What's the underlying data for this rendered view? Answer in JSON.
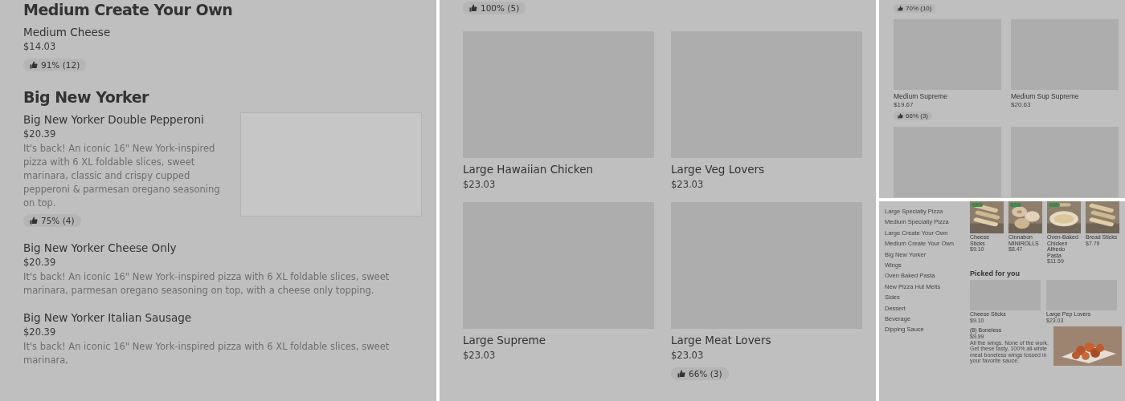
{
  "list_view": {
    "sections": [
      {
        "heading": "Medium Create Your Own",
        "items": [
          {
            "name": "Medium Cheese",
            "price": "$14.03",
            "rating": "91% (12)"
          }
        ]
      },
      {
        "heading": "Big New Yorker",
        "items": [
          {
            "name": "Big New Yorker Double Pepperoni",
            "price": "$20.39",
            "description": "It's back! An iconic 16\" New York-inspired pizza with 6 XL foldable slices, sweet marinara, classic and crispy cupped pepperoni & parmesan oregano seasoning on top.",
            "rating": "75% (4)",
            "image": true
          },
          {
            "name": "Big New Yorker Cheese Only",
            "price": "$20.39",
            "description": "It's back! An iconic 16\" New York-inspired pizza with 6 XL foldable slices, sweet marinara, parmesan oregano seasoning on top, with a cheese only topping."
          },
          {
            "name": "Big New Yorker Italian Sausage",
            "price": "$20.39",
            "description": "It's back! An iconic 16\" New York-inspired pizza with 6 XL foldable slices, sweet marinara,"
          }
        ]
      }
    ]
  },
  "grid_view": {
    "top_rating": "100% (5)",
    "cards": [
      {
        "name": "Large Hawaiian Chicken",
        "price": "$23.03"
      },
      {
        "name": "Large Veg Lovers",
        "price": "$23.03"
      },
      {
        "name": "Large Supreme",
        "price": "$23.03"
      },
      {
        "name": "Large Meat Lovers",
        "price": "$23.03",
        "rating": "66% (3)"
      }
    ]
  },
  "compact_grid_view": {
    "top_rating": "70% (10)",
    "cards": [
      {
        "image": true,
        "name": "Medium Supreme",
        "price": "$19.67",
        "rating": "66% (3)"
      },
      {
        "image": true,
        "name": "Medium Sup Supreme",
        "price": "$20.63"
      },
      {
        "image": true
      },
      {
        "image": true
      }
    ]
  },
  "mobile_view": {
    "categories": [
      {
        "label": "Large Specialty Pizza"
      },
      {
        "label": "Medium Specialty Pizza"
      },
      {
        "label": "Large Create Your Own"
      },
      {
        "label": "Medium Create Your Own"
      },
      {
        "label": "Big New Yorker"
      },
      {
        "label": "Wings"
      },
      {
        "label": "Oven Baked Pasta"
      },
      {
        "label": "New Pizza Hut Melts"
      },
      {
        "label": "Sides"
      },
      {
        "label": "Dessert"
      },
      {
        "label": "Beverage"
      },
      {
        "label": "Dipping Sauce"
      }
    ],
    "popular": [
      {
        "name": "Cheese Sticks",
        "price": "$9.10",
        "badge": true
      },
      {
        "name": "Cinnabon MINIROLLS",
        "price": "$8.47",
        "badge": true
      },
      {
        "name": "Oven-Baked Chicken Alfredo Pasta",
        "price": "$11.59",
        "badge": true
      },
      {
        "name": "Bread Sticks",
        "price": "$7.79",
        "badge": false
      }
    ],
    "picked_heading": "Picked for you",
    "picked": [
      {
        "name": "Cheese Sticks",
        "price": "$9.10"
      },
      {
        "name": "Large Pep Lovers",
        "price": "$23.03"
      }
    ],
    "featured": {
      "name": "(8) Boneless",
      "price": "$9.99",
      "description": "All the wings. None of the work. Get these tasty, 100% all-white meat boneless wings tossed in your favorite sauce."
    }
  }
}
